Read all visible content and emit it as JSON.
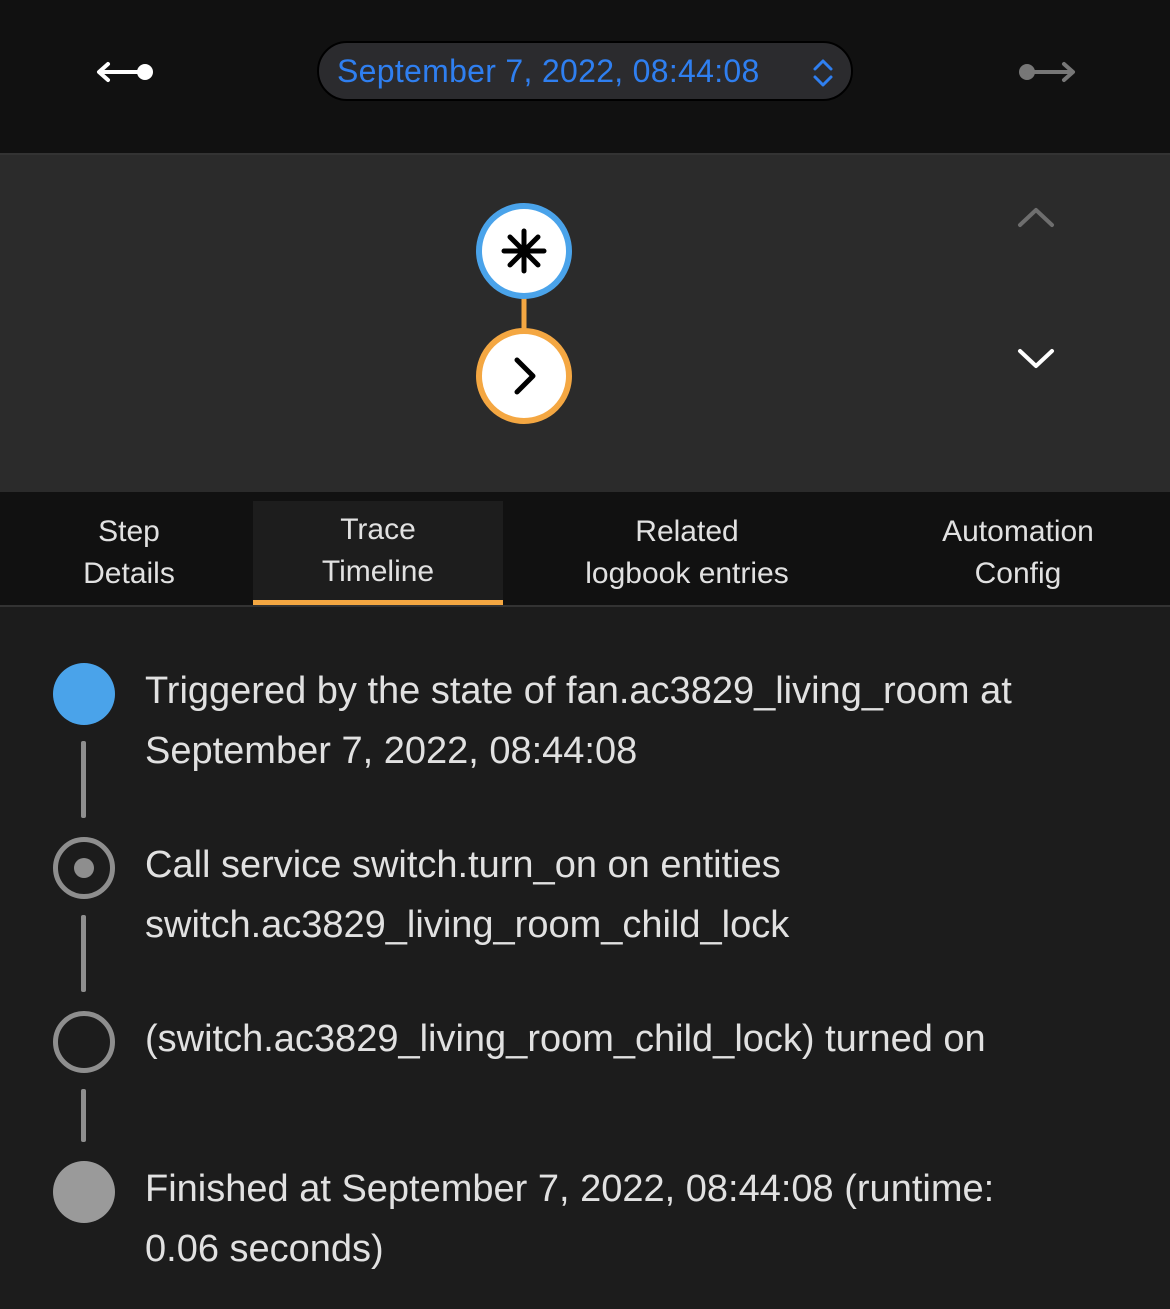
{
  "toolbar": {
    "selected_trace": "September 7, 2022, 08:44:08",
    "prev_icon": "arrow-left-to-dot-icon",
    "next_icon": "arrow-right-from-dot-icon",
    "select_icon": "chevron-up-down-icon"
  },
  "graph": {
    "trigger_node_icon": "asterisk-icon",
    "action_node_icon": "chevron-right-icon",
    "trigger_color": "#4aa3ea",
    "action_color": "#f4a742",
    "nav_up_icon": "chevron-up-icon",
    "nav_down_icon": "chevron-down-icon"
  },
  "tabs": [
    {
      "line1": "Step",
      "line2": "Details",
      "active": false
    },
    {
      "line1": "Trace",
      "line2": "Timeline",
      "active": true
    },
    {
      "line1": "Related",
      "line2": "logbook entries",
      "active": false
    },
    {
      "line1": "Automation",
      "line2": "Config",
      "active": false
    }
  ],
  "timeline": [
    {
      "marker": "filled-blue",
      "line1": "Triggered by the state of fan.ac3829_living_room at",
      "line2": "September 7, 2022, 08:44:08"
    },
    {
      "marker": "radio-dot",
      "line1": "Call service switch.turn_on on entities",
      "line2": "switch.ac3829_living_room_child_lock"
    },
    {
      "marker": "ring",
      "line1": "(switch.ac3829_living_room_child_lock) turned on",
      "line2": ""
    },
    {
      "marker": "filled-gray",
      "line1": "Finished at September 7, 2022, 08:44:08 (runtime:",
      "line2": "0.06 seconds)"
    }
  ],
  "colors": {
    "accent_blue": "#2f7ff0",
    "trigger_blue": "#4aa3ea",
    "tab_underline": "#f4a742",
    "finished_gray": "#9a9a9a"
  }
}
